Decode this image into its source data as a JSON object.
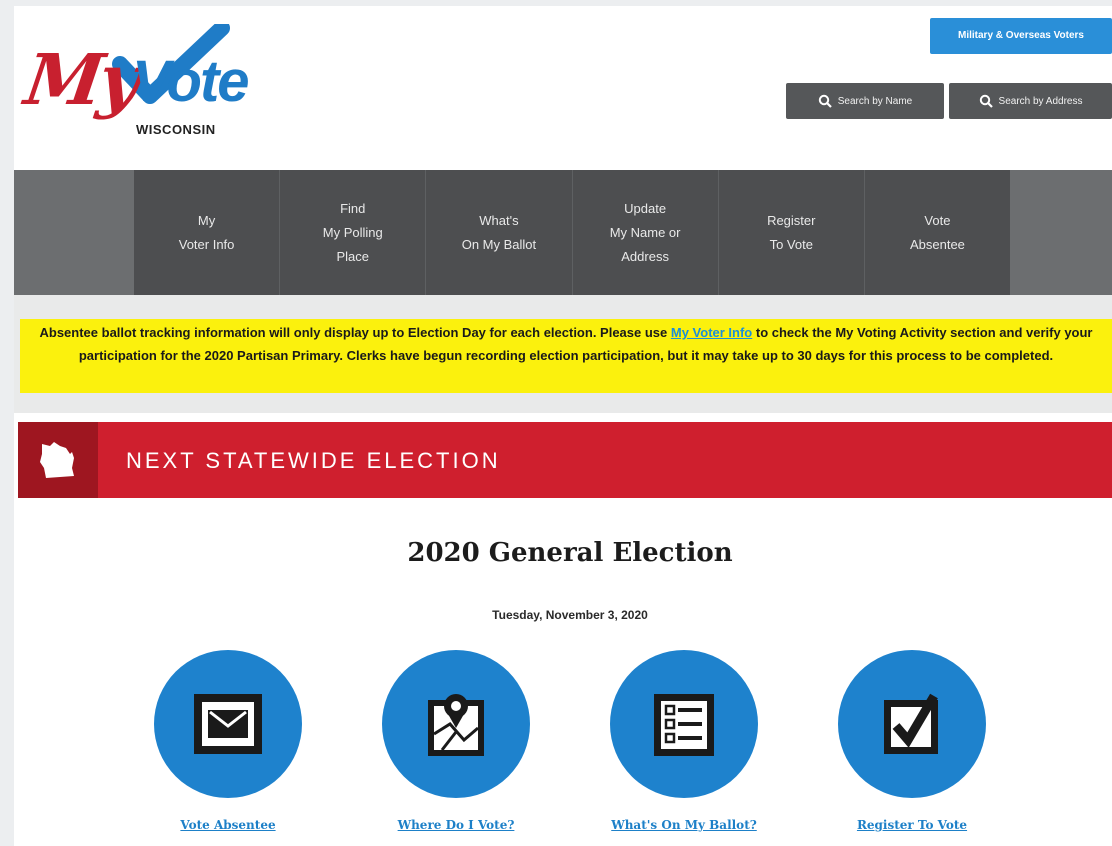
{
  "header": {
    "logo_my": "My",
    "logo_vote": "Vote",
    "logo_state": "WISCONSIN",
    "military_button": "Military & Overseas Voters",
    "search_name_button": "Search by Name",
    "search_address_button": "Search by Address"
  },
  "nav": {
    "items": [
      {
        "label": "My\nVoter Info"
      },
      {
        "label": "Find\nMy Polling\nPlace"
      },
      {
        "label": "What's\nOn My Ballot"
      },
      {
        "label": "Update\nMy Name or\nAddress"
      },
      {
        "label": "Register\nTo Vote"
      },
      {
        "label": "Vote\nAbsentee"
      }
    ]
  },
  "alert": {
    "text_before": "Absentee ballot tracking information will only display up to Election Day for each election. Please use ",
    "link": "My Voter Info",
    "text_after": " to check the My Voting Activity section and verify your participation for the 2020 Partisan Primary. Clerks have begun recording election participation, but it may take up to 30 days for this process to be completed.",
    "background_color": "#fbf10d"
  },
  "banner": {
    "title": "NEXT STATEWIDE ELECTION",
    "icon": "wisconsin-state-icon",
    "color": "#cf1f2e"
  },
  "election": {
    "name": "2020 General Election",
    "date": "Tuesday, November 3, 2020"
  },
  "actions": [
    {
      "label": "Vote Absentee",
      "icon": "envelope-icon"
    },
    {
      "label": "Where Do I Vote?",
      "icon": "map-pin-icon"
    },
    {
      "label": "What's On My Ballot?",
      "icon": "ballot-list-icon"
    },
    {
      "label": "Register To Vote",
      "icon": "checkbox-icon"
    }
  ],
  "colors": {
    "brand_red": "#c8202f",
    "brand_blue": "#1f7cc7",
    "nav_dark": "#4d4e50"
  }
}
